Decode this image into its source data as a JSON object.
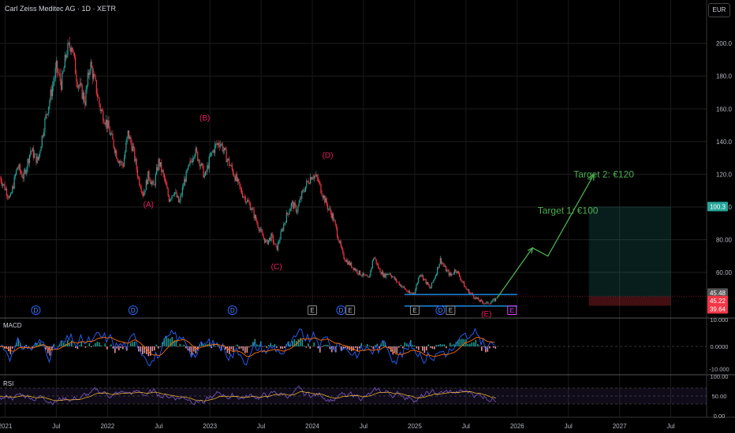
{
  "header": {
    "title": "Carl Zeiss Meditec AG · 1D · XETR",
    "currency": "EUR"
  },
  "chart_data": {
    "type": "candlestick",
    "symbol": "Carl Zeiss Meditec AG",
    "interval": "1D",
    "exchange": "XETR",
    "price_axis": {
      "ticks": [
        "200.0",
        "180.0",
        "160.0",
        "140.0",
        "120.0",
        "100.0",
        "80.00",
        "60.00"
      ],
      "ylim": [
        35,
        215
      ]
    },
    "time_axis": [
      "2021",
      "Jul",
      "2022",
      "Jul",
      "2023",
      "Jul",
      "2024",
      "Jul",
      "2025",
      "Jul",
      "2026",
      "Jul",
      "2027",
      "Jul"
    ],
    "time_values": [
      2021.0,
      2021.5,
      2022.0,
      2022.5,
      2023.0,
      2023.5,
      2024.0,
      2024.5,
      2025.0,
      2025.5,
      2026.0,
      2026.5,
      2027.0,
      2027.5
    ],
    "xlim": [
      2020.95,
      2027.85
    ],
    "price_path": [
      [
        2020.95,
        118
      ],
      [
        2021.05,
        105
      ],
      [
        2021.12,
        125
      ],
      [
        2021.18,
        118
      ],
      [
        2021.25,
        135
      ],
      [
        2021.32,
        128
      ],
      [
        2021.38,
        150
      ],
      [
        2021.45,
        170
      ],
      [
        2021.5,
        185
      ],
      [
        2021.55,
        175
      ],
      [
        2021.6,
        195
      ],
      [
        2021.65,
        200
      ],
      [
        2021.7,
        178
      ],
      [
        2021.78,
        165
      ],
      [
        2021.83,
        188
      ],
      [
        2021.88,
        175
      ],
      [
        2021.93,
        160
      ],
      [
        2022.0,
        150
      ],
      [
        2022.05,
        140
      ],
      [
        2022.1,
        130
      ],
      [
        2022.15,
        125
      ],
      [
        2022.2,
        145
      ],
      [
        2022.25,
        135
      ],
      [
        2022.3,
        118
      ],
      [
        2022.35,
        108
      ],
      [
        2022.4,
        120
      ],
      [
        2022.45,
        112
      ],
      [
        2022.5,
        128
      ],
      [
        2022.55,
        118
      ],
      [
        2022.6,
        105
      ],
      [
        2022.65,
        110
      ],
      [
        2022.7,
        102
      ],
      [
        2022.75,
        116
      ],
      [
        2022.8,
        125
      ],
      [
        2022.85,
        135
      ],
      [
        2022.9,
        128
      ],
      [
        2022.95,
        118
      ],
      [
        2023.0,
        130
      ],
      [
        2023.05,
        137
      ],
      [
        2023.1,
        140
      ],
      [
        2023.15,
        132
      ],
      [
        2023.2,
        125
      ],
      [
        2023.25,
        118
      ],
      [
        2023.3,
        110
      ],
      [
        2023.35,
        105
      ],
      [
        2023.4,
        100
      ],
      [
        2023.45,
        92
      ],
      [
        2023.5,
        84
      ],
      [
        2023.55,
        78
      ],
      [
        2023.6,
        82
      ],
      [
        2023.65,
        74
      ],
      [
        2023.7,
        85
      ],
      [
        2023.75,
        95
      ],
      [
        2023.8,
        102
      ],
      [
        2023.85,
        98
      ],
      [
        2023.9,
        108
      ],
      [
        2023.95,
        115
      ],
      [
        2024.0,
        120
      ],
      [
        2024.05,
        117
      ],
      [
        2024.1,
        108
      ],
      [
        2024.15,
        100
      ],
      [
        2024.2,
        94
      ],
      [
        2024.25,
        82
      ],
      [
        2024.3,
        70
      ],
      [
        2024.35,
        66
      ],
      [
        2024.4,
        63
      ],
      [
        2024.45,
        60
      ],
      [
        2024.5,
        58
      ],
      [
        2024.55,
        56
      ],
      [
        2024.6,
        70
      ],
      [
        2024.65,
        62
      ],
      [
        2024.7,
        58
      ],
      [
        2024.75,
        60
      ],
      [
        2024.8,
        56
      ],
      [
        2024.85,
        53
      ],
      [
        2024.9,
        50
      ],
      [
        2024.95,
        47
      ],
      [
        2025.0,
        48
      ],
      [
        2025.05,
        60
      ],
      [
        2025.1,
        55
      ],
      [
        2025.15,
        50
      ],
      [
        2025.2,
        58
      ],
      [
        2025.25,
        68
      ],
      [
        2025.3,
        62
      ],
      [
        2025.35,
        58
      ],
      [
        2025.4,
        62
      ],
      [
        2025.45,
        56
      ],
      [
        2025.5,
        50
      ],
      [
        2025.55,
        47
      ],
      [
        2025.6,
        44
      ],
      [
        2025.65,
        42
      ],
      [
        2025.7,
        41
      ],
      [
        2025.75,
        42
      ],
      [
        2025.8,
        44
      ]
    ],
    "wave_labels": [
      {
        "text": "(A)",
        "x": 2022.4,
        "y": 100
      },
      {
        "text": "(B)",
        "x": 2022.95,
        "y": 153
      },
      {
        "text": "(C)",
        "x": 2023.65,
        "y": 62
      },
      {
        "text": "(D)",
        "x": 2024.15,
        "y": 130
      },
      {
        "text": "(E)",
        "x": 2025.7,
        "y": 33
      }
    ],
    "annotations": [
      {
        "text": "Target 1: €100",
        "x": 2026.2,
        "y": 96
      },
      {
        "text": "Target 2: €120",
        "x": 2026.55,
        "y": 118
      }
    ],
    "target_arrow": [
      [
        2025.8,
        44
      ],
      [
        2026.15,
        75
      ],
      [
        2026.3,
        70
      ],
      [
        2026.75,
        120
      ]
    ],
    "support_lines": [
      {
        "y": 46.5,
        "x1": 2024.9,
        "x2": 2026.0
      },
      {
        "y": 39.5,
        "x1": 2024.9,
        "x2": 2026.0
      }
    ],
    "position": {
      "x1": 2026.7,
      "x2": 2027.5,
      "entry": 45.22,
      "target": 100.3,
      "stop": 39.64
    },
    "price_labels": [
      {
        "text": "100.3",
        "y": 100.3,
        "color": "#26a69a"
      },
      {
        "text": "45.48",
        "y": 45.48,
        "color": "#555555"
      },
      {
        "text": "45.22",
        "y": 45.22,
        "color": "#f23645"
      },
      {
        "text": "39.64",
        "y": 39.64,
        "color": "#f23645"
      }
    ],
    "event_markers": [
      {
        "label": "D",
        "x": 2021.3,
        "kind": "dividend"
      },
      {
        "label": "D",
        "x": 2022.25,
        "kind": "dividend"
      },
      {
        "label": "D",
        "x": 2023.22,
        "kind": "dividend"
      },
      {
        "label": "E",
        "x": 2024.0,
        "kind": "earnings"
      },
      {
        "label": "D",
        "x": 2024.28,
        "kind": "dividend"
      },
      {
        "label": "E",
        "x": 2024.37,
        "kind": "earnings"
      },
      {
        "label": "E",
        "x": 2025.0,
        "kind": "earnings"
      },
      {
        "label": "D",
        "x": 2025.25,
        "kind": "dividend"
      },
      {
        "label": "E",
        "x": 2025.35,
        "kind": "earnings"
      },
      {
        "label": "E",
        "x": 2025.95,
        "kind": "earnings-upcoming"
      }
    ],
    "macd": {
      "label": "MACD",
      "ticks": [
        "10.000",
        "0.0000",
        "-10.000"
      ]
    },
    "rsi": {
      "label": "RSI",
      "ticks": [
        "100.00",
        "50.00",
        "0.00"
      ]
    },
    "colors": {
      "up": "#26a69a",
      "down": "#f23645",
      "wave": "#e91e63",
      "target": "#4caf50",
      "support": "#2196f3"
    }
  }
}
